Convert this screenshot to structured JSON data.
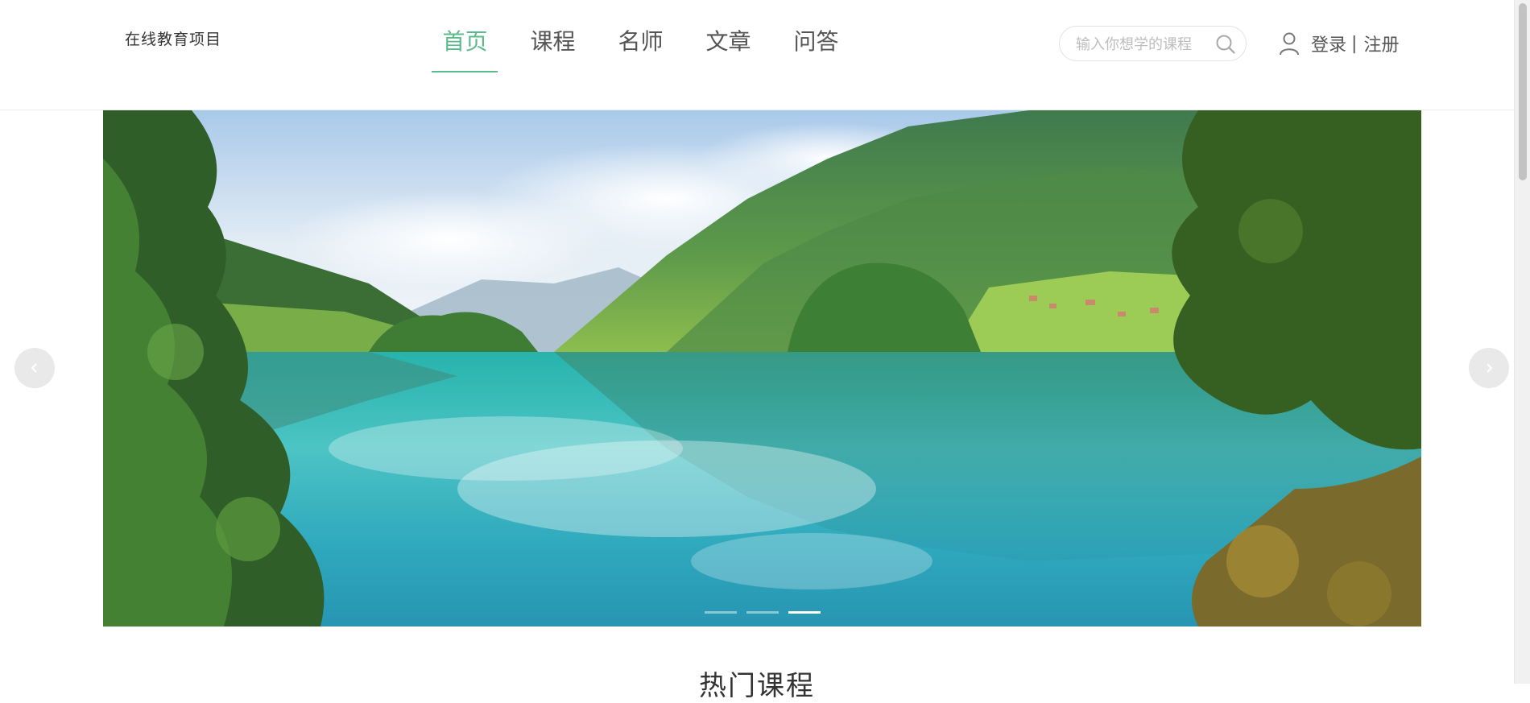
{
  "header": {
    "logo": "在线教育项目",
    "nav": [
      {
        "label": "首页",
        "active": true
      },
      {
        "label": "课程",
        "active": false
      },
      {
        "label": "名师",
        "active": false
      },
      {
        "label": "文章",
        "active": false
      },
      {
        "label": "问答",
        "active": false
      }
    ],
    "search": {
      "placeholder": "输入你想学的课程",
      "value": ""
    },
    "user": {
      "login": "登录",
      "separator": "|",
      "register": "注册"
    }
  },
  "carousel": {
    "image": "lake-mountain-landscape",
    "slides": 3,
    "active_slide": 3
  },
  "section": {
    "title": "热门课程"
  },
  "colors": {
    "accent": "#5cbb8a",
    "text": "#333333",
    "muted": "#555555"
  }
}
